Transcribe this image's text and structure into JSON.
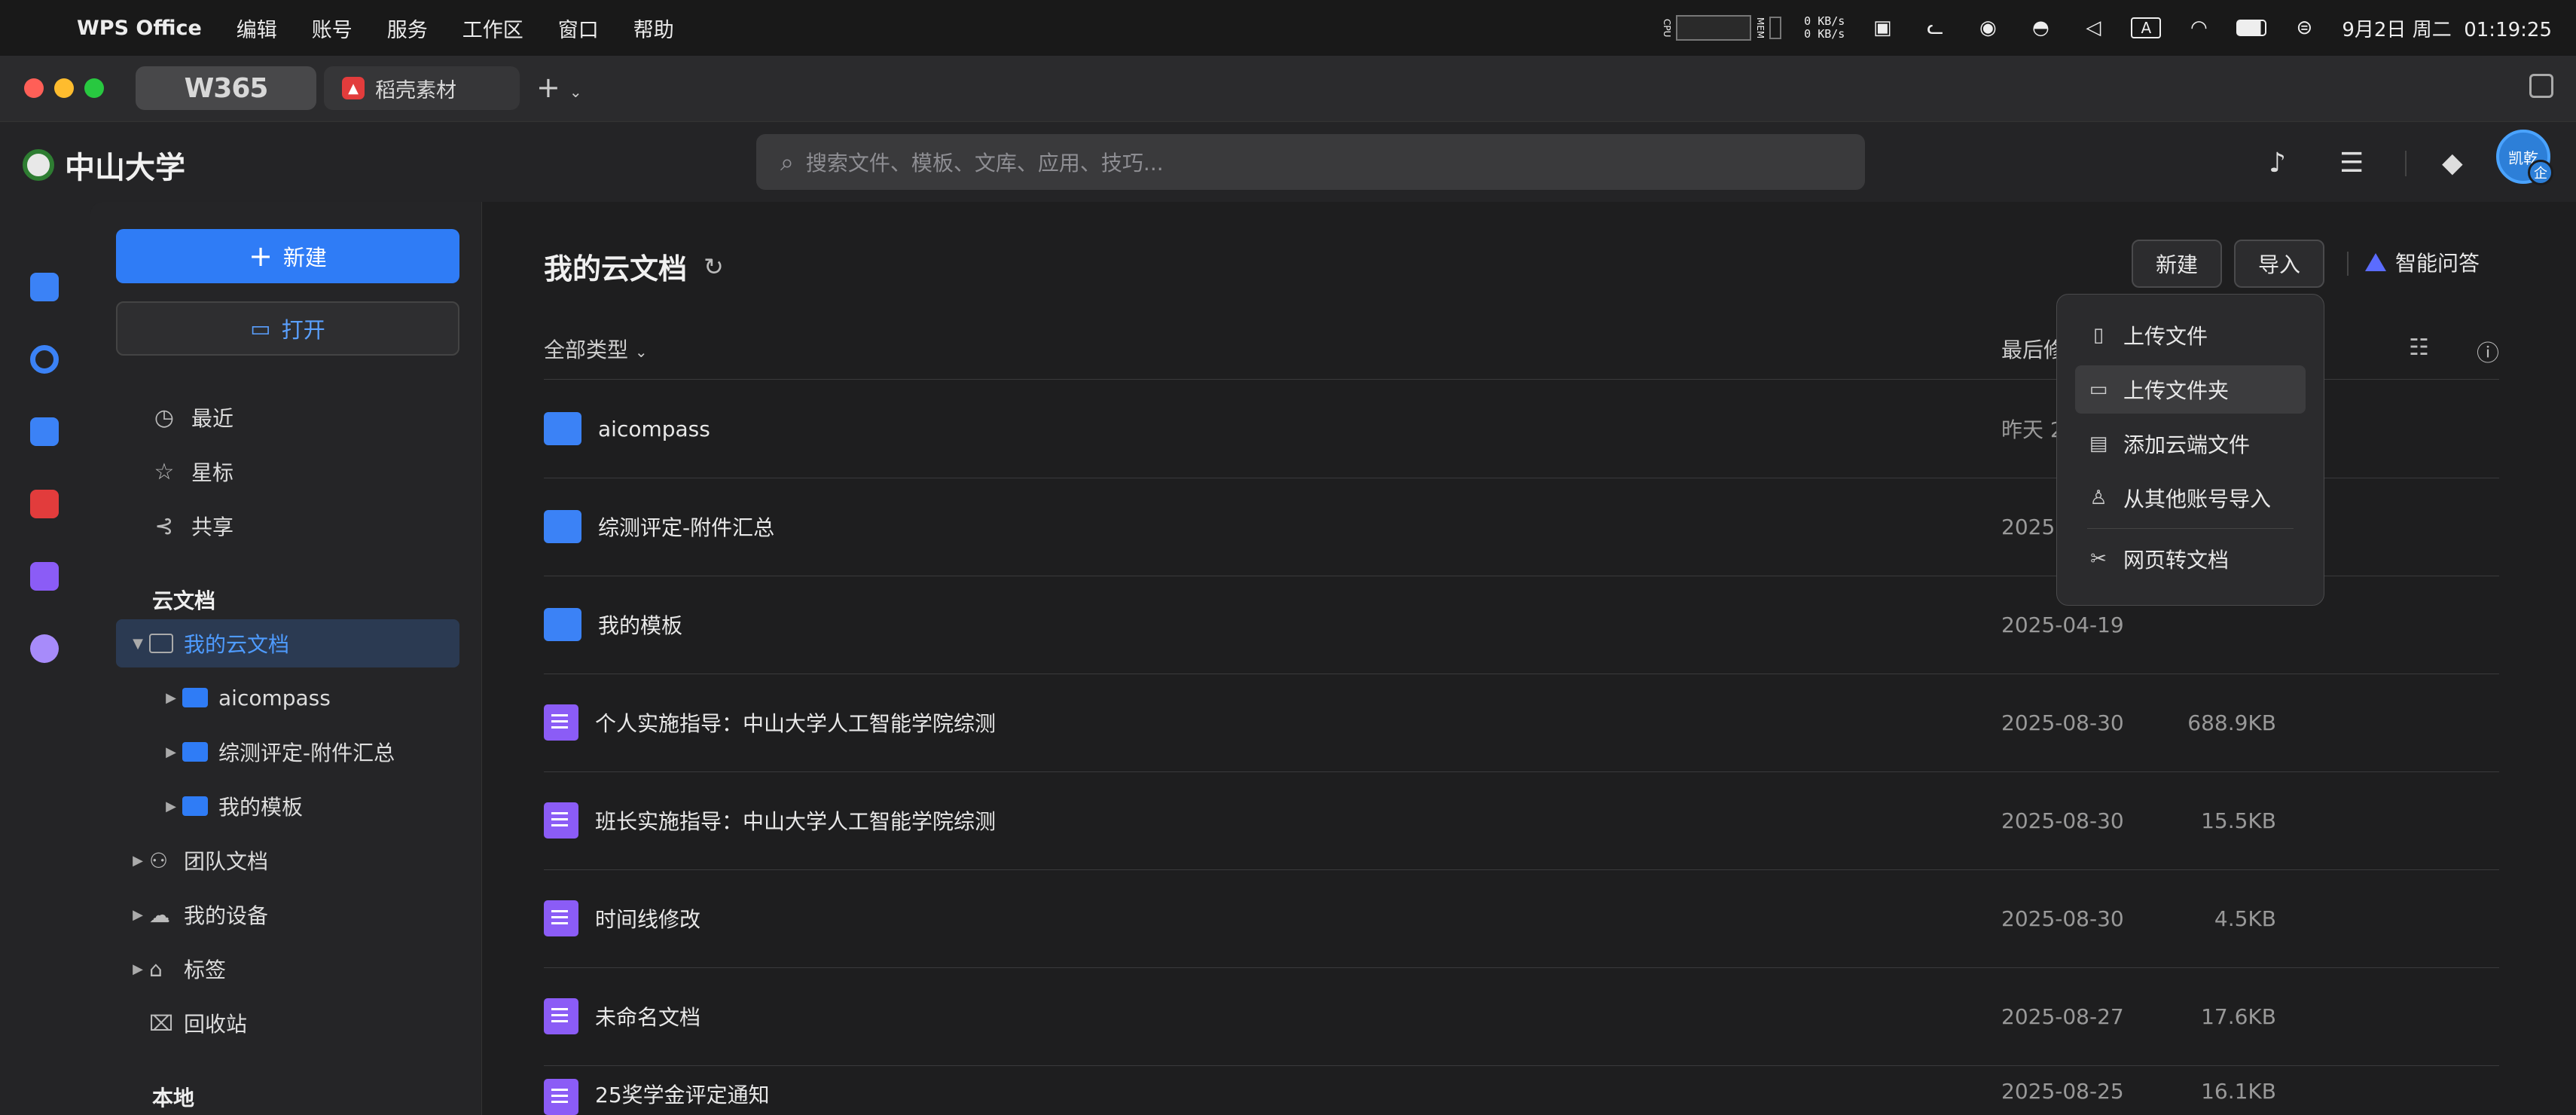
{
  "menubar": {
    "app": "WPS Office",
    "items": [
      "编辑",
      "账号",
      "服务",
      "工作区",
      "窗口",
      "帮助"
    ],
    "net_up": "0 KB/s",
    "net_down": "0 KB/s",
    "cpu_label": "CPU",
    "mem_label": "MEM",
    "ime": "A",
    "datetime": "9月2日 周二  01:19:25"
  },
  "tabs": {
    "tab1": "W365",
    "tab2": "稻壳素材"
  },
  "header": {
    "org": "中山大学",
    "search_placeholder": "搜索文件、模板、文库、应用、技巧...",
    "avatar_text": "凯乾",
    "avatar_badge": "企"
  },
  "sidebar": {
    "new_label": "新建",
    "open_label": "打开",
    "recent": "最近",
    "star": "星标",
    "share": "共享",
    "cloud_section": "云文档",
    "my_cloud": "我的云文档",
    "sub1": "aicompass",
    "sub2": "综测评定-附件汇总",
    "sub3": "我的模板",
    "team": "团队文档",
    "devices": "我的设备",
    "tags": "标签",
    "trash": "回收站",
    "local_section": "本地"
  },
  "main": {
    "title": "我的云文档",
    "new_btn": "新建",
    "import_btn": "导入",
    "ai_label": "智能问答",
    "filter_label": "全部类型",
    "col_modified": "最后修",
    "rows": [
      {
        "name": "aicompass",
        "date": "昨天 2",
        "size": "",
        "type": "folder"
      },
      {
        "name": "综测评定-附件汇总",
        "date": "2025",
        "size": "",
        "type": "folder"
      },
      {
        "name": "我的模板",
        "date": "2025-04-19",
        "size": "",
        "type": "folder"
      },
      {
        "name": "个人实施指导：中山大学人工智能学院综测",
        "date": "2025-08-30",
        "size": "688.9KB",
        "type": "doc"
      },
      {
        "name": "班长实施指导：中山大学人工智能学院综测",
        "date": "2025-08-30",
        "size": "15.5KB",
        "type": "doc"
      },
      {
        "name": "时间线修改",
        "date": "2025-08-30",
        "size": "4.5KB",
        "type": "doc"
      },
      {
        "name": "未命名文档",
        "date": "2025-08-27",
        "size": "17.6KB",
        "type": "doc"
      },
      {
        "name": "25奖学金评定通知",
        "date": "2025-08-25",
        "size": "16.1KB",
        "type": "doc"
      }
    ]
  },
  "dropdown": {
    "upload_file": "上传文件",
    "upload_folder": "上传文件夹",
    "add_cloud": "添加云端文件",
    "import_other": "从其他账号导入",
    "web_to_doc": "网页转文档"
  }
}
